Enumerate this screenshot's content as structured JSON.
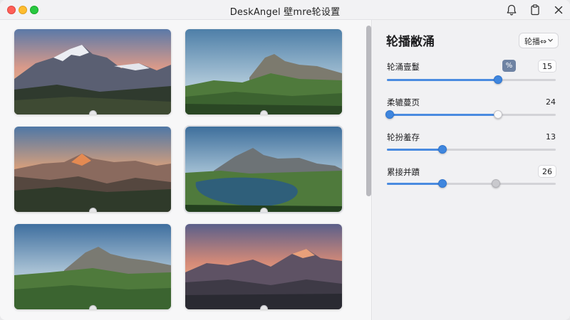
{
  "window": {
    "title": "DeskAngel 壁mre轮设置"
  },
  "titlebar_icons": [
    "bell-icon",
    "clipboard-icon",
    "close-icon"
  ],
  "gallery": {
    "thumbnails": [
      {
        "name": "thumb-alpine-sunset-peaks"
      },
      {
        "name": "thumb-green-ridge-sky"
      },
      {
        "name": "thumb-orange-sunset-range"
      },
      {
        "name": "thumb-mountain-lake"
      },
      {
        "name": "thumb-green-valley-peak"
      },
      {
        "name": "thumb-dusk-peaks"
      }
    ],
    "scroll_position": 0.0
  },
  "panel": {
    "title": "轮播敝涌",
    "dropdown_label": "轮播⇔",
    "settings": [
      {
        "label": "轮涌壹鬘",
        "value": "15",
        "extra_button": "%",
        "slider_fraction": 0.66
      },
      {
        "label": "柔辘蔓页",
        "value": "24",
        "slider_fraction": 0.66
      },
      {
        "label": "轮扮羞存",
        "value": "13",
        "slider_fraction": 0.33
      },
      {
        "label": "累接并蹟",
        "value": "26",
        "slider_fraction": 0.33
      }
    ]
  },
  "colors": {
    "accent": "#3f86de",
    "close": "#fe5f57",
    "minimize": "#febc2e",
    "maximize": "#28c840"
  }
}
